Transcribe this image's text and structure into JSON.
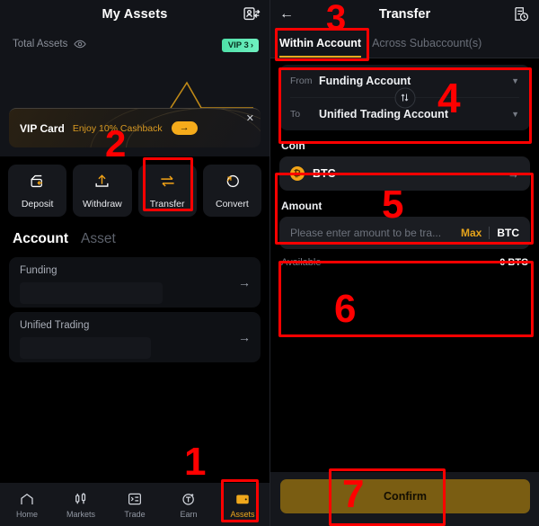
{
  "left": {
    "header": {
      "title": "My Assets",
      "icon": "account-switch-icon"
    },
    "hero": {
      "total_assets_label": "Total Assets",
      "eye_icon": "eye-icon",
      "vip_badge": "VIP 3",
      "vip_badge_chevron": "›",
      "expand_icon": "expand-icon"
    },
    "vip_card": {
      "title": "VIP Card",
      "subtitle": "Enjoy 10% Cashback",
      "arrow": "→",
      "close": "✕"
    },
    "actions": [
      {
        "label": "Deposit",
        "icon": "deposit-icon"
      },
      {
        "label": "Withdraw",
        "icon": "withdraw-icon"
      },
      {
        "label": "Transfer",
        "icon": "transfer-icon"
      },
      {
        "label": "Convert",
        "icon": "convert-icon"
      }
    ],
    "tabs": [
      {
        "label": "Account",
        "active": true
      },
      {
        "label": "Asset",
        "active": false
      }
    ],
    "accounts": [
      {
        "name": "Funding",
        "arrow": "→"
      },
      {
        "name": "Unified Trading",
        "arrow": "→"
      }
    ],
    "bottom_nav": [
      {
        "label": "Home",
        "icon": "home-icon",
        "active": false
      },
      {
        "label": "Markets",
        "icon": "markets-icon",
        "active": false
      },
      {
        "label": "Trade",
        "icon": "trade-icon",
        "active": false
      },
      {
        "label": "Earn",
        "icon": "earn-icon",
        "active": false
      },
      {
        "label": "Assets",
        "icon": "wallet-icon",
        "active": true
      }
    ]
  },
  "right": {
    "header": {
      "back": "←",
      "title": "Transfer",
      "icon": "transfer-history-icon"
    },
    "tabs": [
      {
        "label": "Within Account",
        "active": true
      },
      {
        "label": "Across Subaccount(s)",
        "active": false
      }
    ],
    "from_to": {
      "from_label": "From",
      "from_value": "Funding Account",
      "to_label": "To",
      "to_value": "Unified Trading Account",
      "swap_icon": "swap-icon",
      "caret": "▼"
    },
    "coin": {
      "section_label": "Coin",
      "symbol": "BTC",
      "badge_glyph": "₿",
      "arrow": "→"
    },
    "amount": {
      "section_label": "Amount",
      "placeholder": "Please enter amount to be tra...",
      "value": "",
      "max_label": "Max",
      "unit": "BTC",
      "available_label": "Available",
      "available_value": "0 BTC"
    },
    "confirm_label": "Confirm"
  },
  "annotations": [
    {
      "number": "1"
    },
    {
      "number": "2"
    },
    {
      "number": "3"
    },
    {
      "number": "4"
    },
    {
      "number": "5"
    },
    {
      "number": "6"
    },
    {
      "number": "7"
    }
  ],
  "colors": {
    "accent_orange": "#f0a81c",
    "background": "#000000",
    "surface": "#15171c",
    "annotation_red": "#ff0000",
    "vip_green": "#4fe0a8",
    "confirm_button": "#7a5d12"
  }
}
